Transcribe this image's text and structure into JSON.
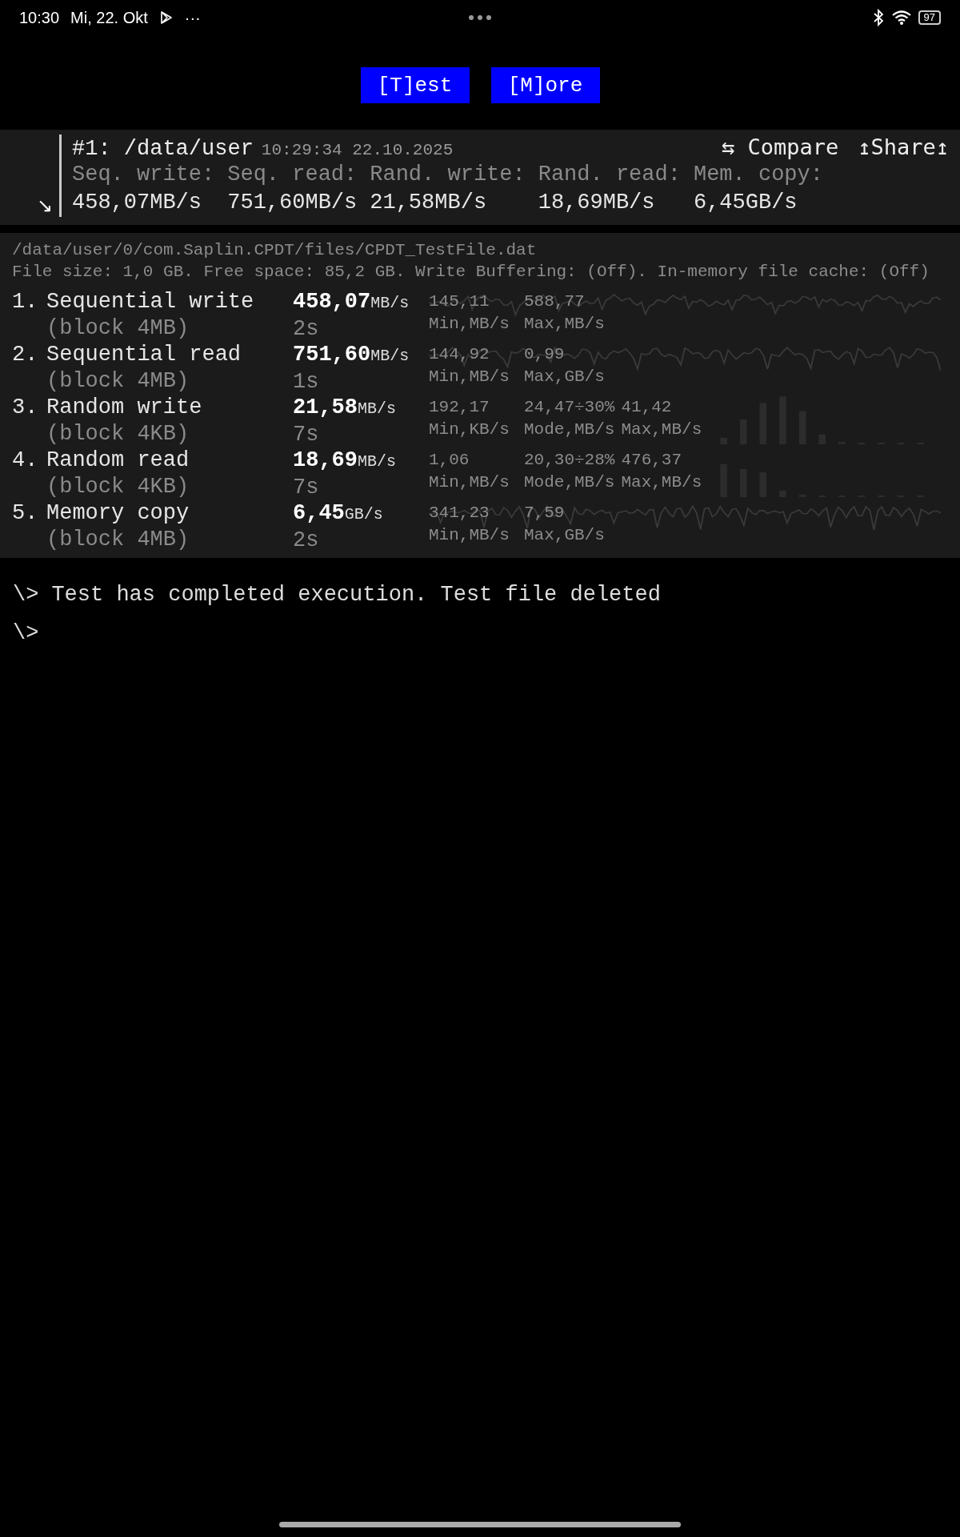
{
  "status_bar": {
    "time": "10:30",
    "date": "Mi, 22. Okt",
    "overflow": "···",
    "battery": "97"
  },
  "toolbar": {
    "buttons": [
      "[T]est",
      "[M]ore"
    ]
  },
  "result_card": {
    "arrow": "↘",
    "title": "#1: /data/user",
    "timestamp": "10:29:34 22.10.2025",
    "compare": "⇆ Compare",
    "share": "↥Share↥",
    "columns": [
      {
        "label": "Seq. write:",
        "value": "458,07MB/s"
      },
      {
        "label": "Seq. read:",
        "value": "751,60MB/s"
      },
      {
        "label": "Rand. write:",
        "value": "21,58MB/s"
      },
      {
        "label": "Rand. read:",
        "value": "18,69MB/s"
      },
      {
        "label": "Mem. copy:",
        "value": "6,45GB/s"
      }
    ]
  },
  "file_info": {
    "path": "/data/user/0/com.Saplin.CPDT/files/CPDT_TestFile.dat",
    "details": "File size: 1,0 GB. Free space: 85,2 GB. Write Buffering: (Off). In-memory file cache: (Off)"
  },
  "tests": [
    {
      "number": "1.",
      "name": "Sequential write",
      "block": "(block 4MB)",
      "value": "458,07",
      "unit": "MB/s",
      "time": "2s",
      "kind": "wave",
      "stats": [
        {
          "value": "145,11",
          "label": "Min,MB/s"
        },
        {
          "value": "588,77",
          "label": "Max,MB/s"
        }
      ]
    },
    {
      "number": "2.",
      "name": "Sequential read",
      "block": "(block 4MB)",
      "value": "751,60",
      "unit": "MB/s",
      "time": "1s",
      "kind": "wave",
      "stats": [
        {
          "value": "144,92",
          "label": "Min,MB/s"
        },
        {
          "value": "0,99",
          "label": "Max,GB/s"
        }
      ]
    },
    {
      "number": "3.",
      "name": "Random write",
      "block": "(block 4KB)",
      "value": "21,58",
      "unit": "MB/s",
      "time": "7s",
      "kind": "bars",
      "stats": [
        {
          "value": "192,17",
          "label": "Min,KB/s"
        },
        {
          "value": "24,47÷30%",
          "label": "Mode,MB/s"
        },
        {
          "value": "41,42",
          "label": "Max,MB/s"
        }
      ]
    },
    {
      "number": "4.",
      "name": "Random read",
      "block": "(block 4KB)",
      "value": "18,69",
      "unit": "MB/s",
      "time": "7s",
      "kind": "bars",
      "stats": [
        {
          "value": "1,06",
          "label": "Min,MB/s"
        },
        {
          "value": "20,30÷28%",
          "label": "Mode,MB/s"
        },
        {
          "value": "476,37",
          "label": "Max,MB/s"
        }
      ]
    },
    {
      "number": "5.",
      "name": "Memory copy",
      "block": "(block 4MB)",
      "value": "6,45",
      "unit": "GB/s",
      "time": "2s",
      "kind": "wave",
      "stats": [
        {
          "value": "341,23",
          "label": "Min,MB/s"
        },
        {
          "value": "7,59",
          "label": "Max,GB/s"
        }
      ]
    }
  ],
  "console": [
    {
      "prompt": "\\>",
      "text": "Test has completed execution. Test file deleted"
    },
    {
      "prompt": "\\>"
    }
  ]
}
